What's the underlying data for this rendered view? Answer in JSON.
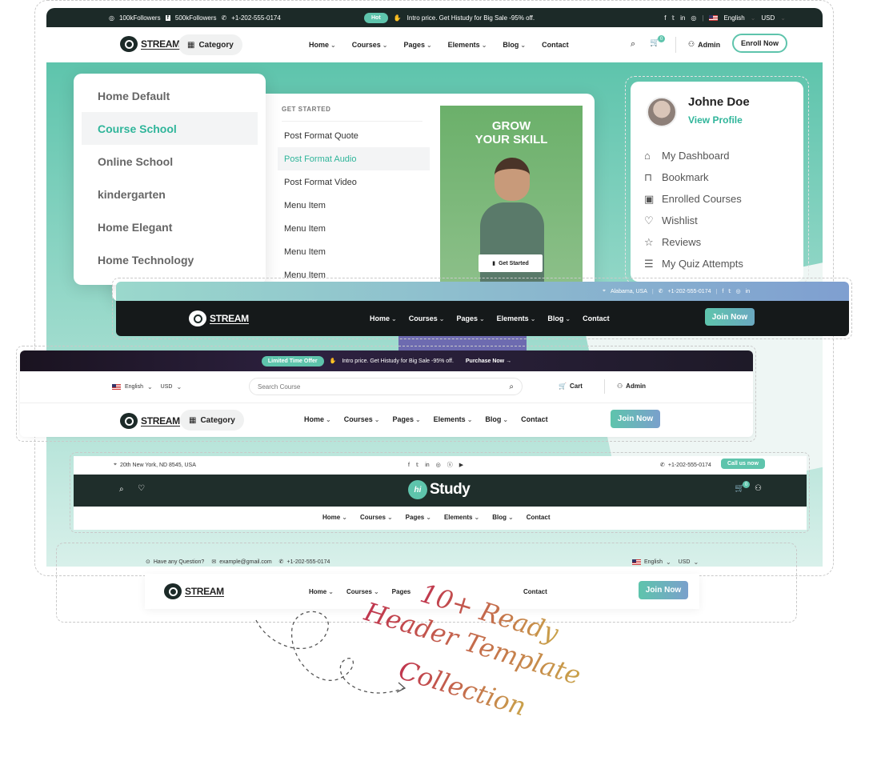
{
  "header1": {
    "followers1": "100kFollowers",
    "followers2": "500kFollowers",
    "phone": "+1-202-555-0174",
    "hot_badge": "Hot",
    "promo": "Intro price. Get Histudy for Big Sale -95% off.",
    "language": "English",
    "currency": "USD",
    "logo": "STREAM",
    "category": "Category",
    "nav": [
      "Home",
      "Courses",
      "Pages",
      "Elements",
      "Blog",
      "Contact"
    ],
    "cart_count": "0",
    "admin": "Admin",
    "enroll": "Enroll Now"
  },
  "home_menu": {
    "items": [
      "Home Default",
      "Course School",
      "Online School",
      "kindergarten",
      "Home Elegant",
      "Home Technology"
    ],
    "active_index": 1
  },
  "mega_menu": {
    "heading": "GET STARTED",
    "items": [
      "Post Format Quote",
      "Post Format Audio",
      "Post Format Video",
      "Menu Item",
      "Menu Item",
      "Menu Item",
      "Menu Item"
    ],
    "active_index": 1,
    "promo_title_1": "GROW",
    "promo_title_2": "YOUR SKILL",
    "promo_button": "Get Started"
  },
  "profile": {
    "name": "Johne Doe",
    "link": "View Profile",
    "items": [
      "My Dashboard",
      "Bookmark",
      "Enrolled Courses",
      "Wishlist",
      "Reviews",
      "My Quiz Attempts"
    ]
  },
  "header2": {
    "location": "Alabama, USA",
    "phone": "+1-202-555-0174",
    "logo": "STREAM",
    "nav": [
      "Home",
      "Courses",
      "Pages",
      "Elements",
      "Blog",
      "Contact"
    ],
    "join": "Join Now"
  },
  "header3": {
    "offer_badge": "Limited Time Offer",
    "promo": "Intro price. Get Histudy for Big Sale -95% off.",
    "purchase": "Purchase Now",
    "language": "English",
    "currency": "USD",
    "search_placeholder": "Search Course",
    "cart": "Cart",
    "admin": "Admin",
    "logo": "STREAM",
    "category": "Category",
    "nav": [
      "Home",
      "Courses",
      "Pages",
      "Elements",
      "Blog",
      "Contact"
    ],
    "join": "Join Now"
  },
  "header4": {
    "address": "20th New York, ND 8545, USA",
    "phone": "+1-202-555-0174",
    "call": "Call us now",
    "logo_badge": "hi",
    "logo": "Study",
    "cart_count": "0",
    "nav": [
      "Home",
      "Courses",
      "Pages",
      "Elements",
      "Blog",
      "Contact"
    ]
  },
  "header5": {
    "question": "Have any Question?",
    "email": "example@gmail.com",
    "phone": "+1-202-555-0174",
    "language": "English",
    "currency": "USD",
    "logo": "STREAM",
    "nav": [
      "Home",
      "Courses",
      "Pages",
      "Contact"
    ],
    "join": "Join Now"
  },
  "tagline": {
    "line1": "10+ Ready",
    "line2": "Header Template",
    "line3": "Collection"
  },
  "colors": {
    "accent": "#2fb59a",
    "dark": "#1c2a28",
    "hero": "#5ec4ac",
    "tagline_red": "#c0354e",
    "tagline_gold": "#c9a24a"
  }
}
